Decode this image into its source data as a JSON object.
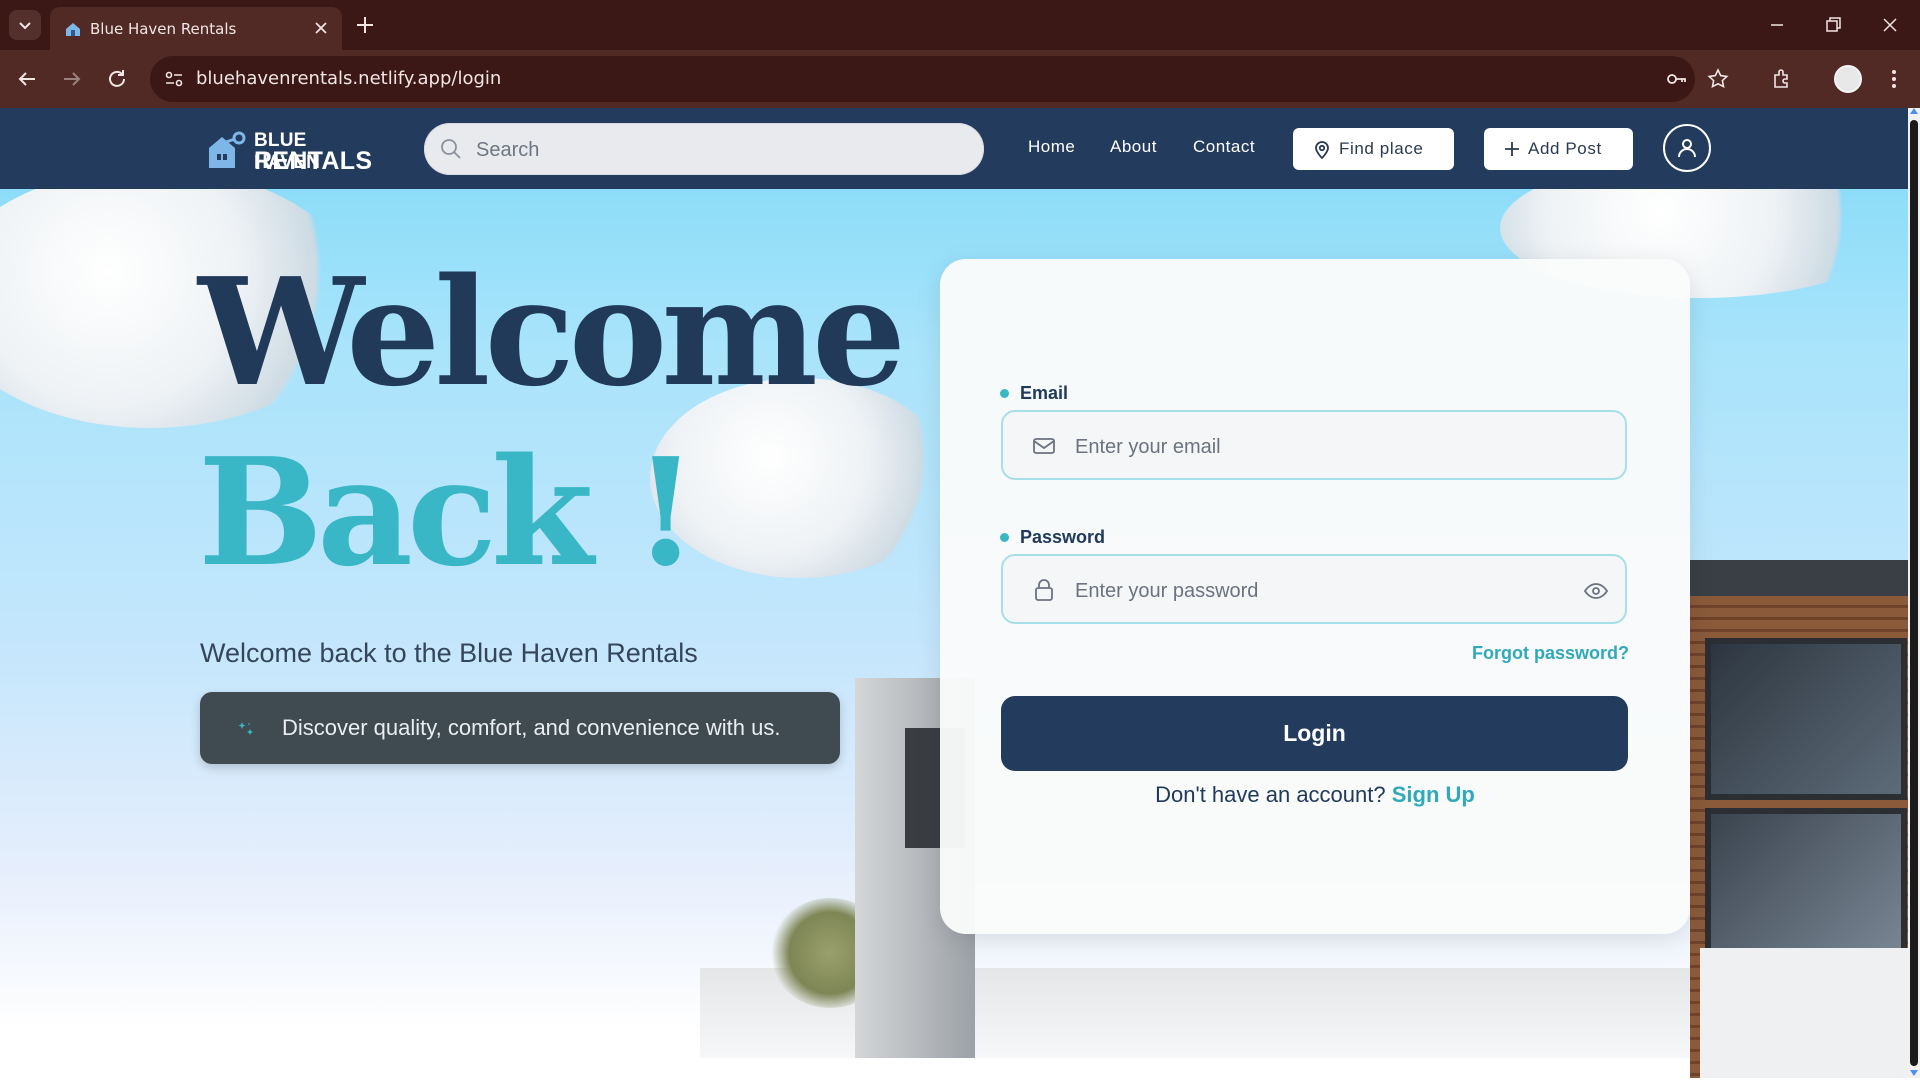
{
  "browser": {
    "tab_title": "Blue Haven Rentals",
    "url": "bluehavenrentals.netlify.app/login"
  },
  "nav": {
    "logo_line1": "BLUE HAVEN",
    "logo_line2": "RENTALS",
    "search_placeholder": "Search",
    "links": [
      "Home",
      "About",
      "Contact"
    ],
    "find_place": "Find place",
    "add_post": "Add Post"
  },
  "hero": {
    "title_line1": "Welcome",
    "title_line2": "Back !",
    "subtitle": "Welcome back to the Blue Haven Rentals",
    "tagline": "Discover quality, comfort, and convenience with us."
  },
  "login": {
    "email_label": "Email",
    "email_placeholder": "Enter your email",
    "password_label": "Password",
    "password_placeholder": "Enter your password",
    "forgot": "Forgot password?",
    "button": "Login",
    "no_account": "Don't have an account?",
    "signup": "Sign Up"
  },
  "colors": {
    "navy": "#233b5c",
    "teal": "#3ab7c6",
    "chrome": "#3b1816"
  }
}
